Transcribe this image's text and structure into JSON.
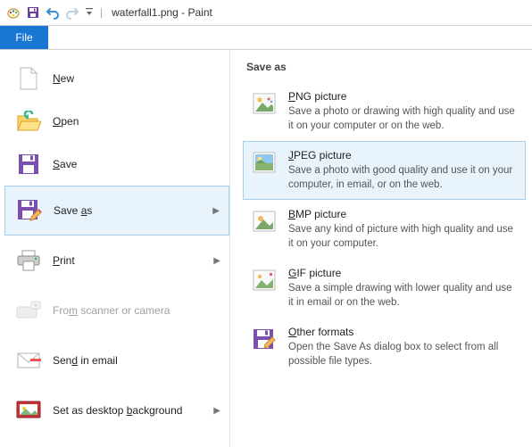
{
  "window": {
    "title": "waterfall1.png - Paint"
  },
  "ribbon": {
    "file_label": "File"
  },
  "file_menu": {
    "items": [
      {
        "label_pre": "",
        "label_ul": "N",
        "label_post": "ew",
        "disabled": false,
        "has_sub": false
      },
      {
        "label_pre": "",
        "label_ul": "O",
        "label_post": "pen",
        "disabled": false,
        "has_sub": false
      },
      {
        "label_pre": "",
        "label_ul": "S",
        "label_post": "ave",
        "disabled": false,
        "has_sub": false
      },
      {
        "label_pre": "Save ",
        "label_ul": "a",
        "label_post": "s",
        "disabled": false,
        "has_sub": true,
        "selected": true
      },
      {
        "label_pre": "",
        "label_ul": "P",
        "label_post": "rint",
        "disabled": false,
        "has_sub": true
      },
      {
        "label_pre": "Fro",
        "label_ul": "m",
        "label_post": " scanner or camera",
        "disabled": true,
        "has_sub": false
      },
      {
        "label_pre": "Sen",
        "label_ul": "d",
        "label_post": " in email",
        "disabled": false,
        "has_sub": false
      },
      {
        "label_pre": "Set as desktop ",
        "label_ul": "b",
        "label_post": "ackground",
        "disabled": false,
        "has_sub": true
      }
    ]
  },
  "save_as_panel": {
    "heading": "Save as",
    "formats": [
      {
        "title_ul": "P",
        "title_post": "NG picture",
        "desc": "Save a photo or drawing with high quality and use it on your computer or on the web.",
        "selected": false
      },
      {
        "title_ul": "J",
        "title_post": "PEG picture",
        "desc": "Save a photo with good quality and use it on your computer, in email, or on the web.",
        "selected": true
      },
      {
        "title_ul": "B",
        "title_post": "MP picture",
        "desc": "Save any kind of picture with high quality and use it on your computer.",
        "selected": false
      },
      {
        "title_ul": "G",
        "title_post": "IF picture",
        "desc": "Save a simple drawing with lower quality and use it in email or on the web.",
        "selected": false
      },
      {
        "title_ul": "O",
        "title_post": "ther formats",
        "desc": "Open the Save As dialog box to select from all possible file types.",
        "selected": false
      }
    ]
  }
}
